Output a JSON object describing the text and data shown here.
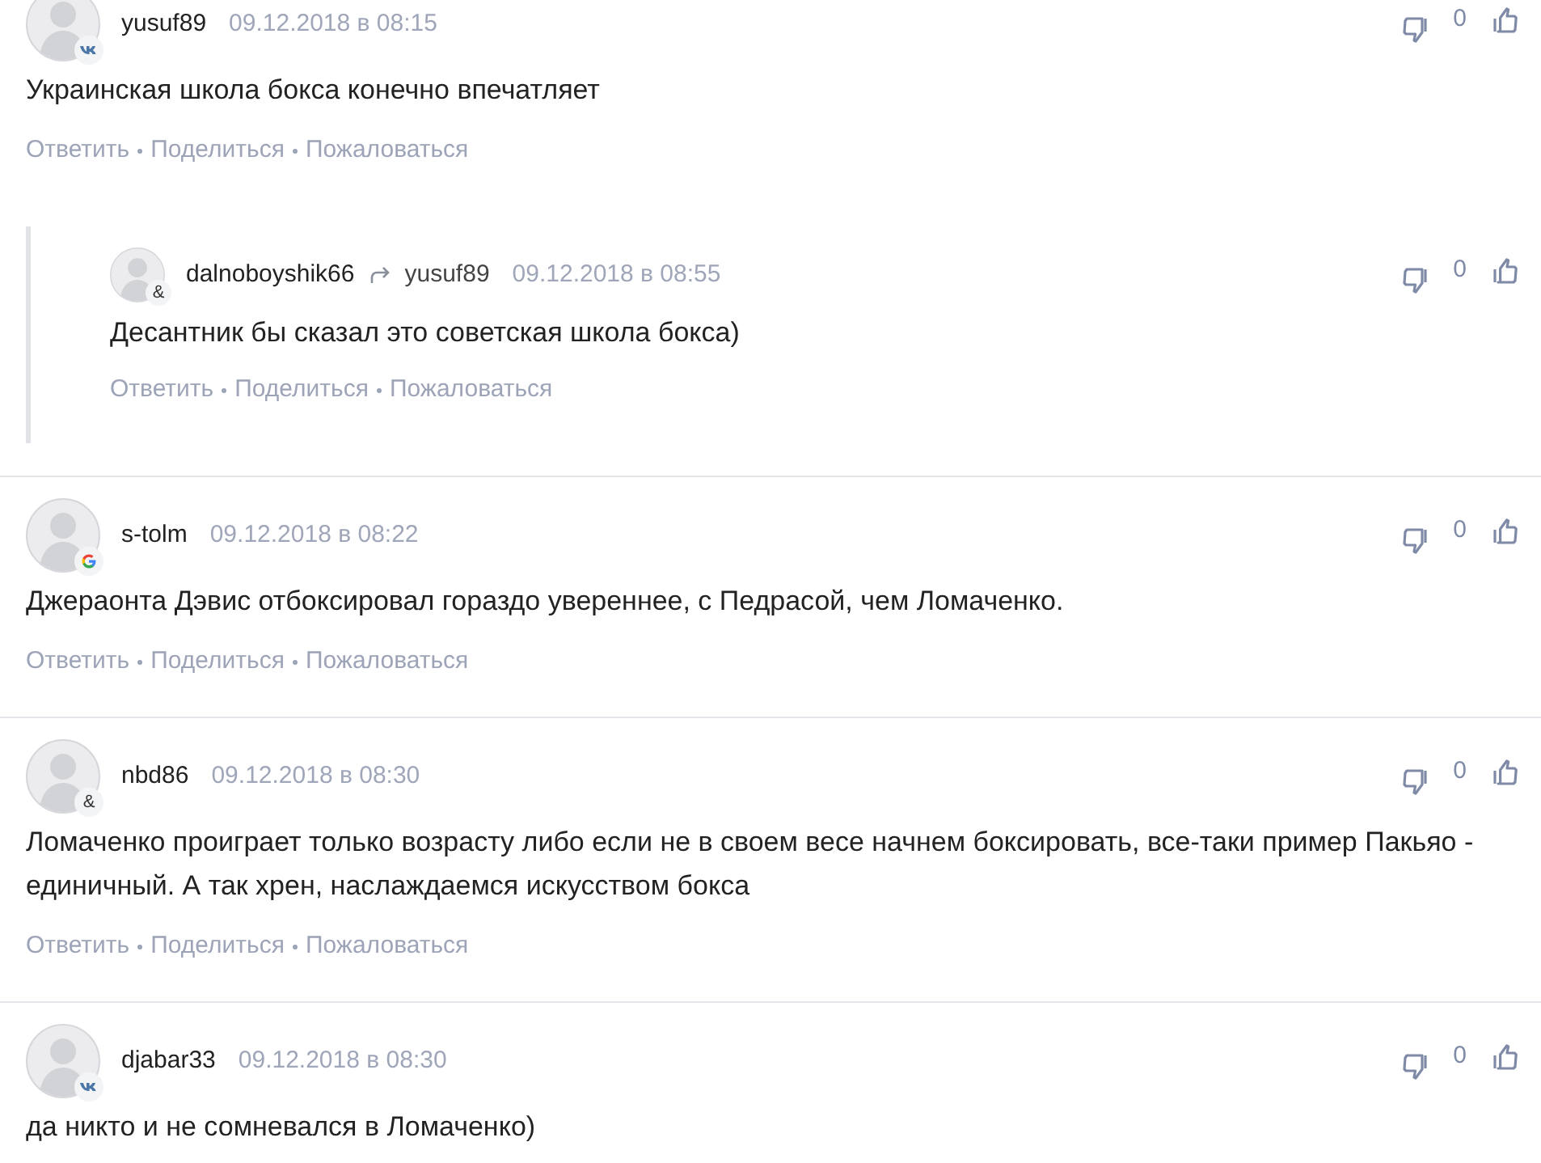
{
  "comments": [
    {
      "author": "yusuf89",
      "badge": {
        "kind": "vk"
      },
      "date": "09.12.2018 в 08:15",
      "text": "Украинская школа бокса конечно впечатляет",
      "votes": "0",
      "actions": [
        "Ответить",
        "Поделиться",
        "Пожаловаться"
      ],
      "replies": [
        {
          "author": "dalnoboyshik66",
          "badge": {
            "kind": "text",
            "label": "&"
          },
          "reply_to": "yusuf89",
          "date": "09.12.2018 в 08:55",
          "text": "Десантник бы сказал это советская школа бокса)",
          "votes": "0",
          "actions": [
            "Ответить",
            "Поделиться",
            "Пожаловаться"
          ]
        }
      ]
    },
    {
      "author": "s-tolm",
      "badge": {
        "kind": "google"
      },
      "date": "09.12.2018 в 08:22",
      "text": "Джераонта Дэвис отбоксировал гораздо увереннее, с Педрасой, чем Ломаченко.",
      "votes": "0",
      "actions": [
        "Ответить",
        "Поделиться",
        "Пожаловаться"
      ]
    },
    {
      "author": "nbd86",
      "badge": {
        "kind": "text",
        "label": "&"
      },
      "date": "09.12.2018 в 08:30",
      "text": "Ломаченко проиграет только возрасту либо если не в своем весе начнем боксировать, все-таки пример Пакьяо - единичный. А так хрен, наслаждаемся искусством бокса",
      "votes": "0",
      "actions": [
        "Ответить",
        "Поделиться",
        "Пожаловаться"
      ]
    },
    {
      "author": "djabar33",
      "badge": {
        "kind": "vk"
      },
      "date": "09.12.2018 в 08:30",
      "text": "да никто и не сомневался в Ломаченко)",
      "votes": "0"
    }
  ]
}
